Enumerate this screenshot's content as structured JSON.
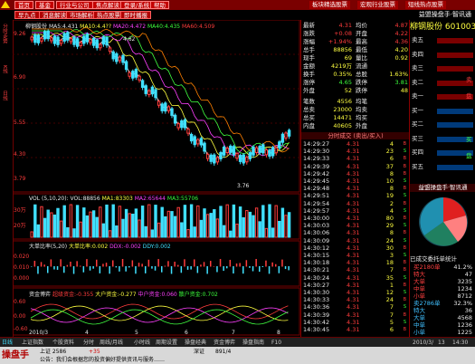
{
  "topbar": {
    "buttons": [
      "首页",
      "基金",
      "行业与公司",
      "焦点解读",
      "登录/系统",
      "帮助"
    ],
    "right_buttons": [
      "板块精选股票",
      "宏观行业股票",
      "短线热点股票"
    ]
  },
  "tabs": [
    "早九点",
    "消息解读",
    "市场解析",
    "热点股票",
    "即时播报"
  ],
  "app_title": "益盟操盘手·智讯通",
  "left_axis": {
    "top_text": "分时走势",
    "mid_text": "K线",
    "bot_text": "日线"
  },
  "chart": {
    "legend_main": {
      "prefix": "柳钢股份",
      "ma5": "MA5:4.431",
      "ma10": "MA10:4.4??",
      "ma20": "MA20:4.472",
      "ma40": "MA40:4.435",
      "ma60": "MA60:4.509"
    },
    "price_labels": [
      "9.26",
      "6.90",
      "5.55",
      "4.30",
      "3.79"
    ],
    "vol_legend": {
      "vol": "VOL (5,10,20):",
      "ma1": "VOL:88856",
      "ma2": "MA1:83303",
      "ma3": "MA2:65644",
      "ma4": "MA3:55706"
    },
    "vol_labels": [
      "30万",
      "20万"
    ],
    "dd_legend": {
      "name": "大单比率(5,20)",
      "v1": "大单比率:0.002",
      "v2": "DDX:-0.002",
      "v3": "DDY:0.002"
    },
    "dd_labels": [
      "0.020",
      "0.010",
      "0.000"
    ],
    "fund_legend": {
      "name": "资金博弈",
      "v1": "超级资金:-0.355",
      "v2": "大户资金:-0.277",
      "v3": "中户资金:0.060",
      "v4": "散户资金:0.702"
    },
    "fund_labels": [
      "0.60",
      "0.00",
      "-0.60"
    ],
    "date_labels": [
      "2010/3",
      "4",
      "5",
      "6",
      "7",
      "8"
    ],
    "max_price_tag": "4.62",
    "min_price_tag": "3.76"
  },
  "quote": {
    "rows": [
      {
        "l": "最新",
        "v": "4.31",
        "l2": "均价",
        "v2": "4.87",
        "c": "red"
      },
      {
        "l": "涨跌",
        "v": "+0.08",
        "l2": "开盘",
        "v2": "4.22",
        "c": "red"
      },
      {
        "l": "涨幅",
        "v": "+1.94%",
        "l2": "最高",
        "v2": "4.36",
        "c": "red"
      },
      {
        "l": "总手",
        "v": "88856",
        "l2": "最低",
        "v2": "4.20",
        "c": "yel"
      },
      {
        "l": "现手",
        "v": "69",
        "l2": "量比",
        "v2": "0.92",
        "c": "yel"
      },
      {
        "l": "金额",
        "v": "4219万",
        "l2": "流通",
        "v2": "",
        "c": "yel"
      },
      {
        "l": "换手",
        "v": "0.35%",
        "l2": "总股",
        "v2": "1.63%",
        "c": "yel"
      },
      {
        "l": "涨停",
        "v": "4.65",
        "l2": "跌停",
        "v2": "3.81",
        "c": "grn"
      },
      {
        "l": "外盘",
        "v": "52",
        "l2": "跌停",
        "v2": "48",
        "c": "yel"
      }
    ],
    "extra": [
      {
        "l": "笔数",
        "v": "4556",
        "v2": "均笔"
      },
      {
        "l": "总卖",
        "v": "23000",
        "v2": "均卖"
      },
      {
        "l": "总买",
        "v": "14471",
        "v2": "均买"
      },
      {
        "l": "内盘",
        "v": "40605",
        "v2": "外盘"
      }
    ],
    "ticks_title": "分时成交 (卖出/买入)",
    "ticks": [
      {
        "t": "14:29:27",
        "p": "4.31",
        "v": "4",
        "d": "B",
        "c": "red"
      },
      {
        "t": "14:29:30",
        "p": "4.31",
        "v": "23",
        "d": "S",
        "c": "red"
      },
      {
        "t": "14:29:33",
        "p": "4.31",
        "v": "6",
        "d": "B",
        "c": "red"
      },
      {
        "t": "14:29:39",
        "p": "4.31",
        "v": "37",
        "d": "B",
        "c": "red"
      },
      {
        "t": "14:29:42",
        "p": "4.31",
        "v": "8",
        "d": "B",
        "c": "red"
      },
      {
        "t": "14:29:45",
        "p": "4.31",
        "v": "10",
        "d": "S",
        "c": "red"
      },
      {
        "t": "14:29:48",
        "p": "4.31",
        "v": "8",
        "d": "B",
        "c": "red"
      },
      {
        "t": "14:29:51",
        "p": "4.31",
        "v": "19",
        "d": "S",
        "c": "red"
      },
      {
        "t": "14:29:54",
        "p": "4.31",
        "v": "2",
        "d": "B",
        "c": "red"
      },
      {
        "t": "14:29:57",
        "p": "4.31",
        "v": "4",
        "d": "S",
        "c": "red"
      },
      {
        "t": "14:30:00",
        "p": "4.31",
        "v": "80",
        "d": "B",
        "c": "red"
      },
      {
        "t": "14:30:03",
        "p": "4.31",
        "v": "29",
        "d": "S",
        "c": "red"
      },
      {
        "t": "14:30:06",
        "p": "4.31",
        "v": "8",
        "d": "B",
        "c": "red"
      },
      {
        "t": "14:30:09",
        "p": "4.31",
        "v": "24",
        "d": "S",
        "c": "red"
      },
      {
        "t": "14:30:12",
        "p": "4.31",
        "v": "30",
        "d": "B",
        "c": "red"
      },
      {
        "t": "14:30:15",
        "p": "4.31",
        "v": "3",
        "d": "S",
        "c": "red"
      },
      {
        "t": "14:30:18",
        "p": "4.31",
        "v": "18",
        "d": "B",
        "c": "red"
      },
      {
        "t": "14:30:21",
        "p": "4.31",
        "v": "7",
        "d": "B",
        "c": "red"
      },
      {
        "t": "14:30:24",
        "p": "4.31",
        "v": "35",
        "d": "S",
        "c": "red"
      },
      {
        "t": "14:30:27",
        "p": "4.31",
        "v": "1",
        "d": "B",
        "c": "red"
      },
      {
        "t": "14:30:30",
        "p": "4.31",
        "v": "12",
        "d": "S",
        "c": "red"
      },
      {
        "t": "14:30:33",
        "p": "4.31",
        "v": "24",
        "d": "B",
        "c": "red"
      },
      {
        "t": "14:30:36",
        "p": "4.31",
        "v": "7",
        "d": "S",
        "c": "red"
      },
      {
        "t": "14:30:39",
        "p": "4.31",
        "v": "7",
        "d": "B",
        "c": "red"
      },
      {
        "t": "14:30:42",
        "p": "4.31",
        "v": "5",
        "d": "S",
        "c": "red"
      },
      {
        "t": "14:30:45",
        "p": "4.31",
        "v": "6",
        "d": "B",
        "c": "red"
      }
    ]
  },
  "far": {
    "stock_name": "柳钢股份",
    "stock_code": "601003",
    "bid_ask_labels": [
      "卖五",
      "卖四",
      "卖三",
      "卖二",
      "卖一",
      "买一",
      "买二",
      "买三",
      "买四",
      "买五"
    ],
    "side_labels": [
      "卖",
      "盘",
      "买",
      "盘"
    ],
    "panel_title": "益盟操盘手·智讯通",
    "pie_title": "已成交委托单统计",
    "pie_rows": [
      {
        "l": "买2180单",
        "v": "41.2%"
      },
      {
        "l": "特大",
        "v": "47"
      },
      {
        "l": "大单",
        "v": "3235"
      },
      {
        "l": "中单",
        "v": "1234"
      },
      {
        "l": "小单",
        "v": "8712"
      },
      {
        "l": "卖2786单",
        "v": "32.3%"
      },
      {
        "l": "特大",
        "v": "36"
      },
      {
        "l": "大单",
        "v": "4568"
      },
      {
        "l": "中单",
        "v": "1236"
      },
      {
        "l": "小单",
        "v": "1225"
      }
    ]
  },
  "bottombar": {
    "items": [
      "日线",
      "上证指数",
      "个股资料",
      "分时",
      "周线/月线",
      "小时线",
      "周期设置",
      "操盘经典",
      "资金博弈",
      "操盘指南",
      "F10"
    ],
    "right_items": [
      "2010/3/",
      "13",
      "14:30"
    ]
  },
  "statusbar": {
    "brand": "操盘手",
    "idx1": "上证 2586",
    "idx1_chg": "+35",
    "idx2": "深证",
    "idx2_val": "891/4",
    "ticker_text": "公告：我们会根据您的投资偏好提供资讯与服务……"
  },
  "colors": {
    "up": "#ff3c3c",
    "down": "#3cff3c",
    "accent": "#c40000",
    "bg": "#000000"
  }
}
